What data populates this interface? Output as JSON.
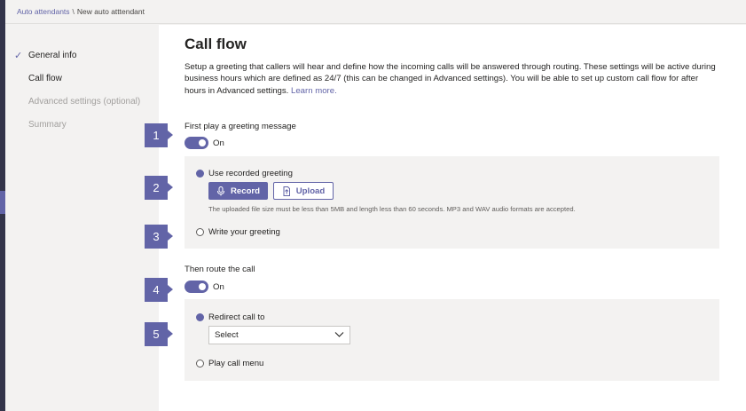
{
  "breadcrumb": {
    "parent": "Auto attendants",
    "separator": "\\",
    "current": "New auto atttendant"
  },
  "sidebar": {
    "items": [
      {
        "label": "General info",
        "state": "completed"
      },
      {
        "label": "Call flow",
        "state": "active"
      },
      {
        "label": "Advanced settings (optional)",
        "state": "disabled"
      },
      {
        "label": "Summary",
        "state": "disabled"
      }
    ]
  },
  "main": {
    "title": "Call flow",
    "description": "Setup a greeting that callers will hear and define how the incoming calls will be answered through routing. These settings will be active during business hours which are defined as 24/7 (this can be changed in Advanced settings). You will be able to set up custom call flow for after hours in Advanced settings.",
    "learn_more": "Learn more.",
    "greeting": {
      "label": "First play a greeting message",
      "toggle_state": "On",
      "options": [
        {
          "label": "Use recorded greeting",
          "selected": true
        },
        {
          "label": "Write your greeting",
          "selected": false
        }
      ],
      "record_button": "Record",
      "upload_button": "Upload",
      "hint": "The uploaded file size must be less than 5MB and length less than 60 seconds. MP3 and WAV audio formats are accepted."
    },
    "routing": {
      "label": "Then route the call",
      "toggle_state": "On",
      "options": [
        {
          "label": "Redirect call to",
          "selected": true
        },
        {
          "label": "Play call menu",
          "selected": false
        }
      ],
      "select_value": "Select"
    }
  },
  "callouts": [
    "1",
    "2",
    "3",
    "4",
    "5"
  ],
  "colors": {
    "accent": "#6264a7",
    "rail": "#33344a",
    "panel": "#f3f2f1"
  }
}
